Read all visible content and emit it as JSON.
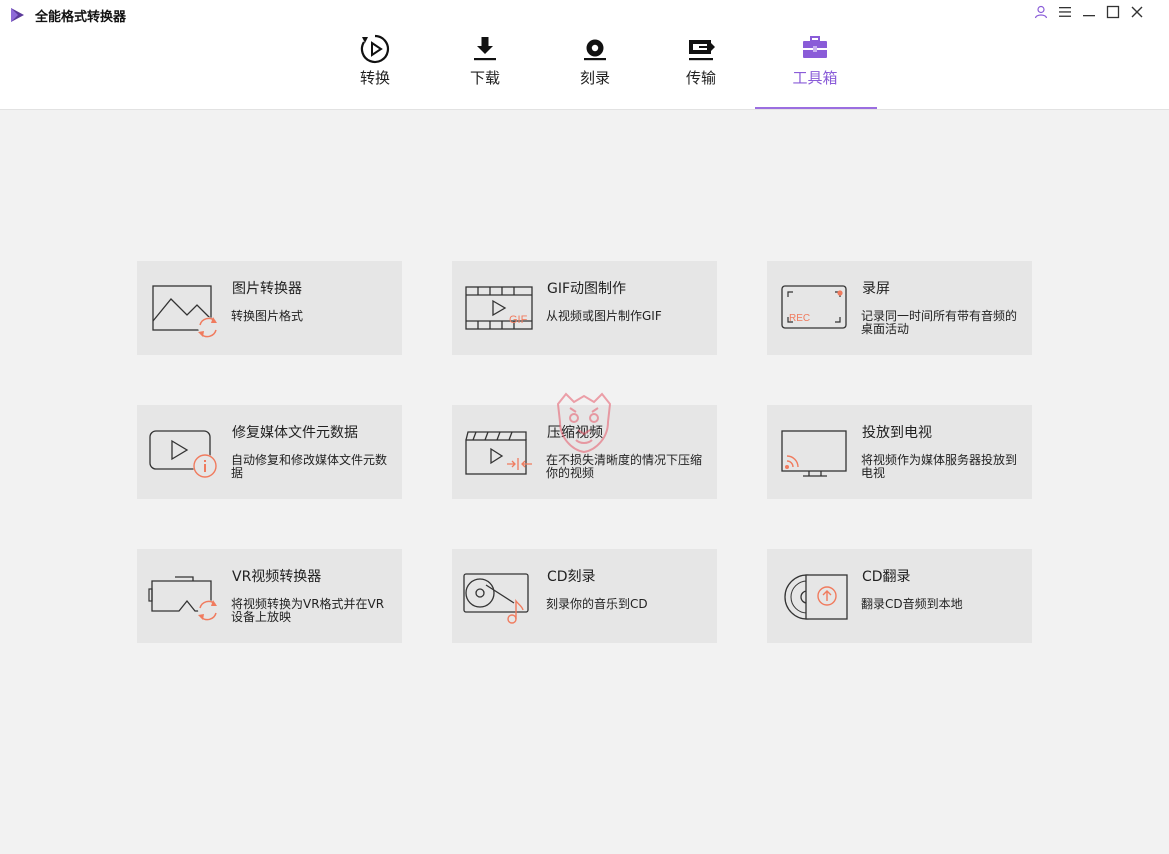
{
  "app": {
    "title": "全能格式转换器"
  },
  "nav": {
    "tabs": [
      {
        "label": "转换",
        "icon": "convert-icon"
      },
      {
        "label": "下载",
        "icon": "download-icon"
      },
      {
        "label": "刻录",
        "icon": "burn-icon"
      },
      {
        "label": "传输",
        "icon": "transfer-icon"
      },
      {
        "label": "工具箱",
        "icon": "toolbox-icon"
      }
    ],
    "active": "工具箱"
  },
  "tools": [
    {
      "title": "图片转换器",
      "desc": "转换图片格式",
      "icon": "image-convert-icon"
    },
    {
      "title": "GIF动图制作",
      "desc": "从视频或图片制作GIF",
      "icon": "gif-maker-icon",
      "icon_text": "GIF"
    },
    {
      "title": "录屏",
      "desc": "记录同一时间所有带有音频的桌面活动",
      "icon": "screen-record-icon",
      "icon_text": "REC"
    },
    {
      "title": "修复媒体文件元数据",
      "desc": "自动修复和修改媒体文件元数据",
      "icon": "metadata-fix-icon"
    },
    {
      "title": "压缩视频",
      "desc": "在不损失清晰度的情况下压缩你的视频",
      "icon": "compress-video-icon"
    },
    {
      "title": "投放到电视",
      "desc": "将视频作为媒体服务器投放到电视",
      "icon": "cast-tv-icon"
    },
    {
      "title": "VR视频转换器",
      "desc": "将视频转换为VR格式并在VR设备上放映",
      "icon": "vr-convert-icon"
    },
    {
      "title": "CD刻录",
      "desc": "刻录你的音乐到CD",
      "icon": "cd-burn-icon"
    },
    {
      "title": "CD翻录",
      "desc": "翻录CD音频到本地",
      "icon": "cd-rip-icon"
    }
  ],
  "colors": {
    "accent": "#8a5cd8",
    "icon_accent": "#f07b5e",
    "card_bg": "#e6e6e6"
  }
}
